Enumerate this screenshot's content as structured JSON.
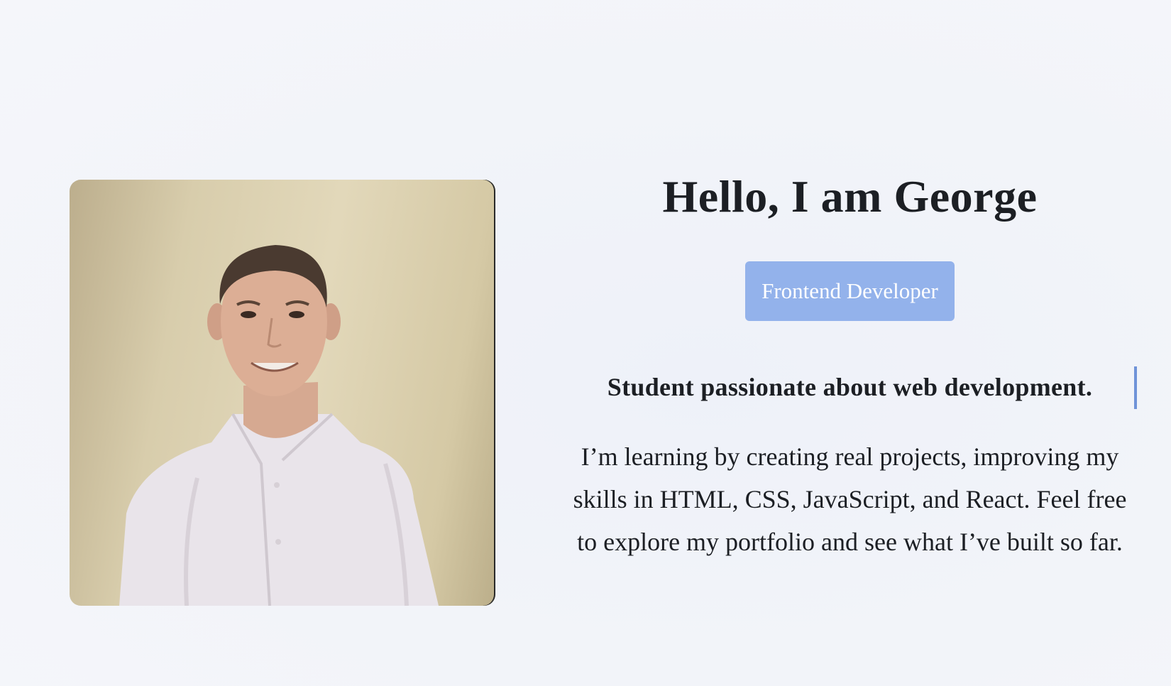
{
  "hero": {
    "photo_alt": "Portrait of George",
    "title": "Hello, I am George",
    "role": "Frontend Developer",
    "tagline": "Student passionate about web development.",
    "description": "I’m learning by creating real projects, improving my skills in HTML, CSS, JavaScript, and React. Feel free to explore my portfolio and see what I’ve built so far."
  },
  "colors": {
    "background": "#f2f4f9",
    "text": "#1c1f24",
    "badge": "#93b2eb",
    "cursor": "#6f93d8"
  }
}
